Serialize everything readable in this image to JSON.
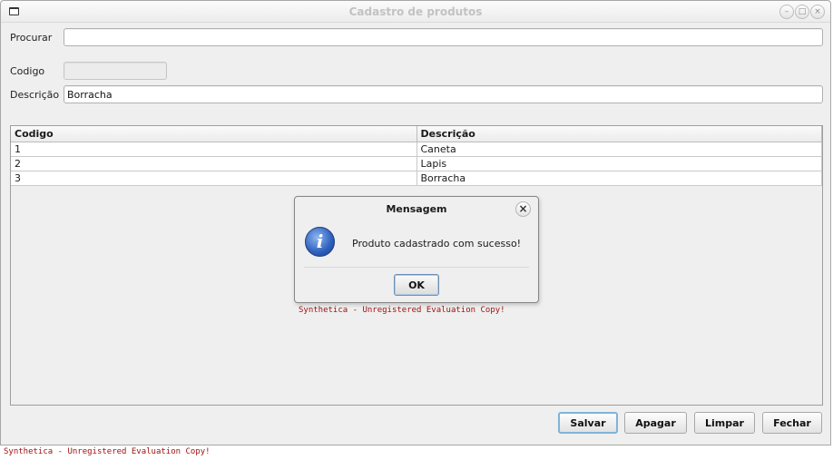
{
  "window": {
    "title": "Cadastro de produtos",
    "controls": [
      "minimize",
      "maximize",
      "close"
    ]
  },
  "form": {
    "search_label": "Procurar",
    "search_value": "",
    "code_label": "Codigo",
    "code_value": "",
    "description_label": "Descrição",
    "description_value": "Borracha"
  },
  "table": {
    "columns": [
      "Codigo",
      "Descrição"
    ],
    "rows": [
      [
        "1",
        "Caneta"
      ],
      [
        "2",
        "Lapis"
      ],
      [
        "3",
        "Borracha"
      ]
    ]
  },
  "dialog": {
    "title": "Mensagem",
    "icon": "info-icon",
    "message": "Produto cadastrado com sucesso!",
    "ok_label": "OK",
    "close_symbol": "×"
  },
  "buttons": {
    "save": "Salvar",
    "delete": "Apagar",
    "clear": "Limpar",
    "close": "Fechar"
  },
  "watermark": "Synthetica - Unregistered Evaluation Copy!"
}
